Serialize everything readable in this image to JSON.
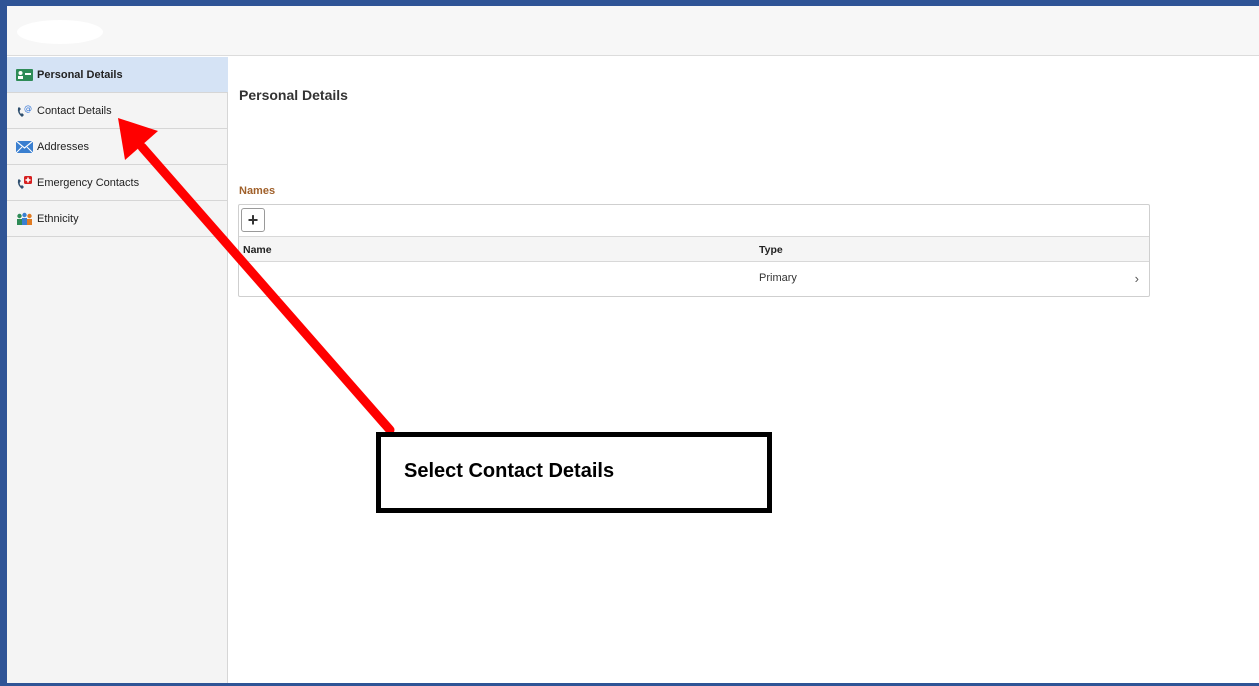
{
  "sidebar": {
    "items": [
      {
        "label": "Personal Details",
        "icon": "id-card-icon",
        "active": true
      },
      {
        "label": "Contact Details",
        "icon": "phone-email-icon",
        "active": false
      },
      {
        "label": "Addresses",
        "icon": "envelope-icon",
        "active": false
      },
      {
        "label": "Emergency Contacts",
        "icon": "emergency-phone-icon",
        "active": false
      },
      {
        "label": "Ethnicity",
        "icon": "people-icon",
        "active": false
      }
    ]
  },
  "main": {
    "title": "Personal Details",
    "names_section": {
      "title": "Names",
      "add_label": "+",
      "columns": [
        "Name",
        "Type"
      ],
      "rows": [
        {
          "name": "",
          "type": "Primary"
        }
      ]
    }
  },
  "annotation": {
    "callout_text": "Select Contact Details",
    "arrow_color": "#ff0000"
  },
  "colors": {
    "frame_border": "#2f5496",
    "active_nav": "#d5e3f5",
    "section_title": "#a0602a"
  }
}
